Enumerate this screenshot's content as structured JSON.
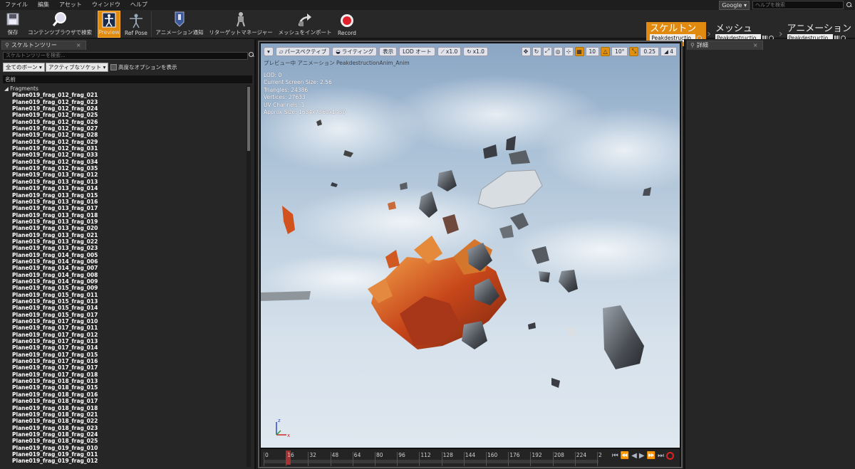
{
  "menu": [
    "ファイル",
    "編集",
    "アセット",
    "ウィンドウ",
    "ヘルプ"
  ],
  "search": {
    "provider": "Google",
    "placeholder": "ヘルプを検索"
  },
  "toolbar": {
    "save": "保存",
    "browse": "コンテンツブラウザで検索",
    "preview": "Preview",
    "ref_pose": "Ref Pose",
    "anim_notify": "アニメーション通知",
    "retarget": "リターゲットマネージャー",
    "import_mesh": "メッシュをインポート",
    "record": "Record"
  },
  "modes": [
    {
      "title": "スケルトン",
      "asset": "Peakdestructio"
    },
    {
      "title": "メッシュ",
      "asset": "Peakdestructio"
    },
    {
      "title": "アニメーション",
      "asset": "Peakdestructio"
    }
  ],
  "skeleton_panel": {
    "tab": "スケルトンツリー",
    "search_placeholder": "スケルトンツリーを検索...",
    "bone_filter": "全てのボーン",
    "socket_filter": "アクティブなソケット",
    "advanced_label": "高度なオプションを表示",
    "column_header": "名前",
    "root": "Fragments",
    "items": [
      "Plane019_frag_012_frag_021",
      "Plane019_frag_012_frag_023",
      "Plane019_frag_012_frag_024",
      "Plane019_frag_012_frag_025",
      "Plane019_frag_012_frag_026",
      "Plane019_frag_012_frag_027",
      "Plane019_frag_012_frag_028",
      "Plane019_frag_012_frag_029",
      "Plane019_frag_012_frag_031",
      "Plane019_frag_012_frag_033",
      "Plane019_frag_012_frag_034",
      "Plane019_frag_012_frag_035",
      "Plane019_frag_013_frag_012",
      "Plane019_frag_013_frag_013",
      "Plane019_frag_013_frag_014",
      "Plane019_frag_013_frag_015",
      "Plane019_frag_013_frag_016",
      "Plane019_frag_013_frag_017",
      "Plane019_frag_013_frag_018",
      "Plane019_frag_013_frag_019",
      "Plane019_frag_013_frag_020",
      "Plane019_frag_013_frag_021",
      "Plane019_frag_013_frag_022",
      "Plane019_frag_013_frag_023",
      "Plane019_frag_014_frag_005",
      "Plane019_frag_014_frag_006",
      "Plane019_frag_014_frag_007",
      "Plane019_frag_014_frag_008",
      "Plane019_frag_014_frag_009",
      "Plane019_frag_015_frag_009",
      "Plane019_frag_015_frag_011",
      "Plane019_frag_015_frag_013",
      "Plane019_frag_015_frag_014",
      "Plane019_frag_015_frag_017",
      "Plane019_frag_017_frag_010",
      "Plane019_frag_017_frag_011",
      "Plane019_frag_017_frag_012",
      "Plane019_frag_017_frag_013",
      "Plane019_frag_017_frag_014",
      "Plane019_frag_017_frag_015",
      "Plane019_frag_017_frag_016",
      "Plane019_frag_017_frag_017",
      "Plane019_frag_017_frag_018",
      "Plane019_frag_018_frag_013",
      "Plane019_frag_018_frag_015",
      "Plane019_frag_018_frag_016",
      "Plane019_frag_018_frag_017",
      "Plane019_frag_018_frag_018",
      "Plane019_frag_018_frag_021",
      "Plane019_frag_018_frag_022",
      "Plane019_frag_018_frag_023",
      "Plane019_frag_018_frag_024",
      "Plane019_frag_018_frag_025",
      "Plane019_frag_019_frag_010",
      "Plane019_frag_019_frag_011",
      "Plane019_frag_019_frag_012"
    ]
  },
  "viewport": {
    "perspective": "パースペクティブ",
    "lighting": "ライティング",
    "show": "表示",
    "lod": "LOD オート",
    "speed1": "x1.0",
    "speed2": "x1.0",
    "grid_snap": "10",
    "rot_snap": "10°",
    "scale_snap": "0.25",
    "cam_speed": "4",
    "caption": "プレビュー中 アニメーション PeakdestructionAnim_Anim",
    "stats": [
      "LOD: 0",
      "Current Screen Size: 2.56",
      "Triangles: 24386",
      "Vertices: 27633",
      "UV Channels: 1",
      "Approx Size: 1634x7360x1430"
    ]
  },
  "timeline": {
    "ticks": [
      "0",
      "16",
      "32",
      "48",
      "64",
      "80",
      "96",
      "112",
      "128",
      "144",
      "160",
      "176",
      "192",
      "208",
      "224",
      "2"
    ],
    "current_frame": 16
  },
  "details_panel": {
    "tab": "詳細"
  }
}
